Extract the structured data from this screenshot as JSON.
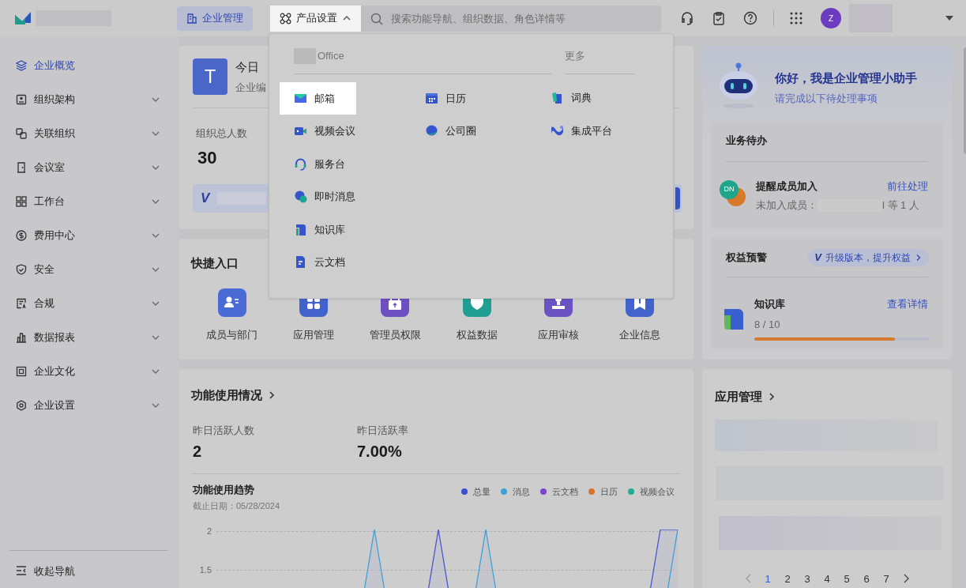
{
  "top_bar": {
    "nav": [
      {
        "label": "企业管理",
        "selected": true
      }
    ],
    "product_menu": {
      "label": "产品设置",
      "expanded": true
    },
    "search": {
      "placeholder": "搜索功能导航、组织数据、角色详情等"
    },
    "avatar": "Z"
  },
  "product_dropdown": {
    "sections": [
      {
        "title": "Office",
        "columns": [
          [
            {
              "label": "邮箱",
              "selected": true
            },
            {
              "label": "视频会议",
              "selected": false
            },
            {
              "label": "服务台",
              "selected": false
            },
            {
              "label": "即时消息",
              "selected": false
            },
            {
              "label": "知识库",
              "selected": false
            },
            {
              "label": "云文档",
              "selected": false
            }
          ],
          [
            {
              "label": "日历",
              "selected": false
            },
            {
              "label": "公司圈",
              "selected": false
            }
          ]
        ]
      },
      {
        "title": "更多",
        "columns": [
          [
            {
              "label": "词典",
              "selected": false
            },
            {
              "label": "集成平台",
              "selected": false
            }
          ]
        ]
      }
    ]
  },
  "sidebar": {
    "items": [
      {
        "label": "企业概览",
        "kind": "link",
        "selected": true
      },
      {
        "label": "组织架构",
        "kind": "group",
        "selected": false,
        "expanded": false
      },
      {
        "label": "关联组织",
        "kind": "group",
        "selected": false,
        "expanded": false
      },
      {
        "label": "会议室",
        "kind": "group",
        "selected": false,
        "expanded": false
      },
      {
        "label": "工作台",
        "kind": "group",
        "selected": false,
        "expanded": false
      },
      {
        "label": "费用中心",
        "kind": "group",
        "selected": false,
        "expanded": false
      },
      {
        "label": "安全",
        "kind": "group",
        "selected": false,
        "expanded": false
      },
      {
        "label": "合规",
        "kind": "group",
        "selected": false,
        "expanded": false
      },
      {
        "label": "数据报表",
        "kind": "group",
        "selected": false,
        "expanded": false
      },
      {
        "label": "企业文化",
        "kind": "group",
        "selected": false,
        "expanded": false
      },
      {
        "label": "企业设置",
        "kind": "group",
        "selected": false,
        "expanded": false
      }
    ],
    "collapse": "收起导航"
  },
  "overview": {
    "avatar": "T",
    "title": "今日",
    "subtitle": "企业编",
    "total_label": "组织总人数",
    "total": "30",
    "banner_badge": "V"
  },
  "shortcuts": {
    "title": "快捷入口",
    "items": [
      "成员与部门",
      "应用管理",
      "管理员权限",
      "权益数据",
      "应用审核",
      "企业信息"
    ]
  },
  "usage": {
    "title": "功能使用情况",
    "stats": [
      {
        "label": "昨日活跃人数",
        "value": "2"
      },
      {
        "label": "昨日活跃率",
        "value": "7.00%"
      }
    ],
    "trend": {
      "title": "功能使用趋势",
      "date": "截止日期：05/28/2024",
      "y_labels": [
        "2",
        "1.5"
      ],
      "legend": [
        {
          "name": "总量",
          "color": "#3b4fd0"
        },
        {
          "name": "消息",
          "color": "#3ea0d6"
        },
        {
          "name": "云文档",
          "color": "#7a45cf"
        },
        {
          "name": "日历",
          "color": "#d8732a"
        },
        {
          "name": "视频会议",
          "color": "#1fae95"
        }
      ]
    }
  },
  "assistant": {
    "greeting": "你好，我是企业管理小助手",
    "subtitle": "请完成以下待处理事项",
    "todo": {
      "title": "业务待办",
      "item": {
        "title": "提醒成员加入",
        "link": "前往处理",
        "detail_label": "未加入成员：",
        "detail_suffix": "l 等 1 人",
        "avatars": [
          {
            "text": "DN",
            "color": "#1fa58c"
          },
          {
            "color": "#d8792a"
          }
        ]
      }
    },
    "benefits": {
      "title": "权益预警",
      "upgrade_badge": "V",
      "upgrade": "升级版本，提升权益",
      "item": {
        "name": "知识库",
        "usage": "8 / 10",
        "level": 0.8,
        "link": "查看详情"
      }
    }
  },
  "apps": {
    "title": "应用管理",
    "pages": [
      {
        "label": "1",
        "selected": true
      },
      {
        "label": "2",
        "selected": false
      },
      {
        "label": "3",
        "selected": false
      },
      {
        "label": "4",
        "selected": false
      },
      {
        "label": "5",
        "selected": false
      },
      {
        "label": "6",
        "selected": false
      },
      {
        "label": "7",
        "selected": false
      }
    ]
  }
}
